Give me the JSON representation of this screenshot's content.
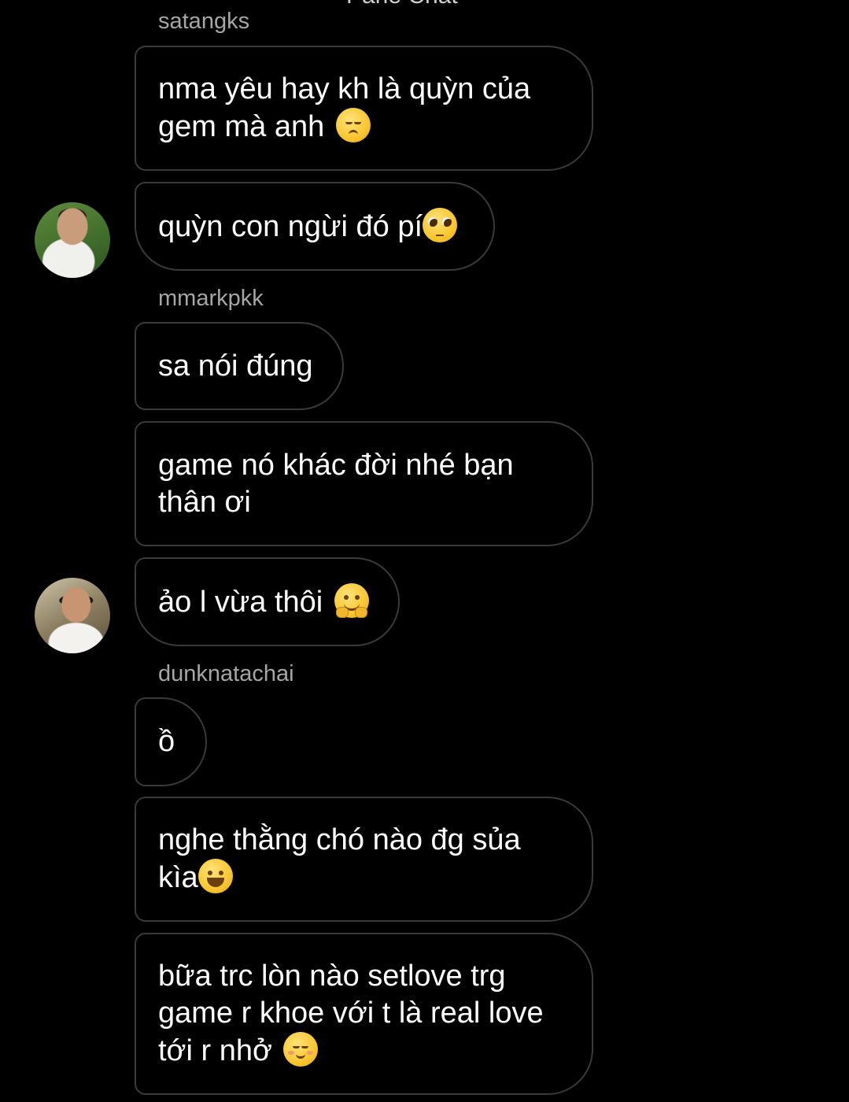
{
  "chat": {
    "title": "Parle Chat",
    "senders": {
      "s1": "satangks",
      "s2": "mmarkpkk",
      "s3": "dunknatachai"
    },
    "messages": [
      {
        "text": "nma yêu hay kh là quỳn của gem mà anh",
        "emoji": "pensive-face"
      },
      {
        "text": "quỳn con ngừi đó pí",
        "emoji": "pleading-face"
      },
      {
        "text": "sa nói đúng"
      },
      {
        "text": "game nó khác đời nhé bạn thân ơi"
      },
      {
        "text": "ảo l vừa thôi",
        "emoji": "hugging-face"
      },
      {
        "text": "ồ"
      },
      {
        "text": "nghe thằng chó nào đg sủa kìa",
        "emoji": "grinning-face"
      },
      {
        "text": "bữa trc lòn nào setlove trg game r khoe với t là real love tới r nhở",
        "emoji": "smiling-face"
      }
    ]
  }
}
